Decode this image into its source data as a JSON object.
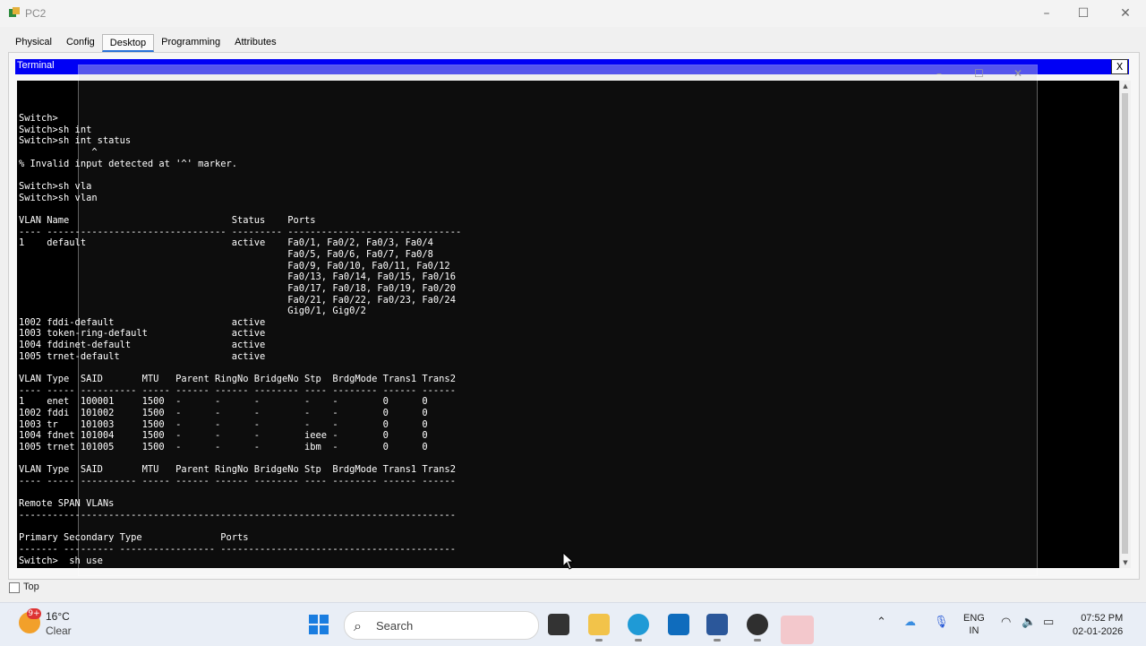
{
  "window": {
    "title": "PC2",
    "minimize": "–",
    "maximize": "☐",
    "close": "✕"
  },
  "tabs": [
    {
      "label": "Physical"
    },
    {
      "label": "Config"
    },
    {
      "label": "Desktop",
      "active": true
    },
    {
      "label": "Programming"
    },
    {
      "label": "Attributes"
    }
  ],
  "terminal": {
    "title": "Terminal",
    "close_label": "X",
    "lines": [
      "Switch>",
      "Switch>sh int",
      "Switch>sh int status",
      "             ^",
      "% Invalid input detected at '^' marker.",
      "",
      "Switch>sh vla",
      "Switch>sh vlan",
      "",
      "VLAN Name                             Status    Ports",
      "---- -------------------------------- --------- -------------------------------",
      "1    default                          active    Fa0/1, Fa0/2, Fa0/3, Fa0/4",
      "                                                Fa0/5, Fa0/6, Fa0/7, Fa0/8",
      "                                                Fa0/9, Fa0/10, Fa0/11, Fa0/12",
      "                                                Fa0/13, Fa0/14, Fa0/15, Fa0/16",
      "                                                Fa0/17, Fa0/18, Fa0/19, Fa0/20",
      "                                                Fa0/21, Fa0/22, Fa0/23, Fa0/24",
      "                                                Gig0/1, Gig0/2",
      "1002 fddi-default                     active",
      "1003 token-ring-default               active",
      "1004 fddinet-default                  active",
      "1005 trnet-default                    active",
      "",
      "VLAN Type  SAID       MTU   Parent RingNo BridgeNo Stp  BrdgMode Trans1 Trans2",
      "---- ----- ---------- ----- ------ ------ -------- ---- -------- ------ ------",
      "1    enet  100001     1500  -      -      -        -    -        0      0",
      "1002 fddi  101002     1500  -      -      -        -    -        0      0",
      "1003 tr    101003     1500  -      -      -        -    -        0      0",
      "1004 fdnet 101004     1500  -      -      -        ieee -        0      0",
      "1005 trnet 101005     1500  -      -      -        ibm  -        0      0",
      "",
      "VLAN Type  SAID       MTU   Parent RingNo BridgeNo Stp  BrdgMode Trans1 Trans2",
      "---- ----- ---------- ----- ------ ------ -------- ---- -------- ------ ------",
      "",
      "Remote SPAN VLANs",
      "------------------------------------------------------------------------------",
      "",
      "Primary Secondary Type              Ports",
      "------- --------- ----------------- ------------------------------------------",
      "Switch>  sh use"
    ]
  },
  "top_checkbox": {
    "label": "Top",
    "checked": false
  },
  "taskbar": {
    "weather": {
      "badge": "9+",
      "temp": "16°C",
      "desc": "Clear"
    },
    "search_label": "Search",
    "language": {
      "line1": "ENG",
      "line2": "IN"
    },
    "clock": {
      "time": "07:52 PM",
      "date": "02-01-2026"
    }
  }
}
